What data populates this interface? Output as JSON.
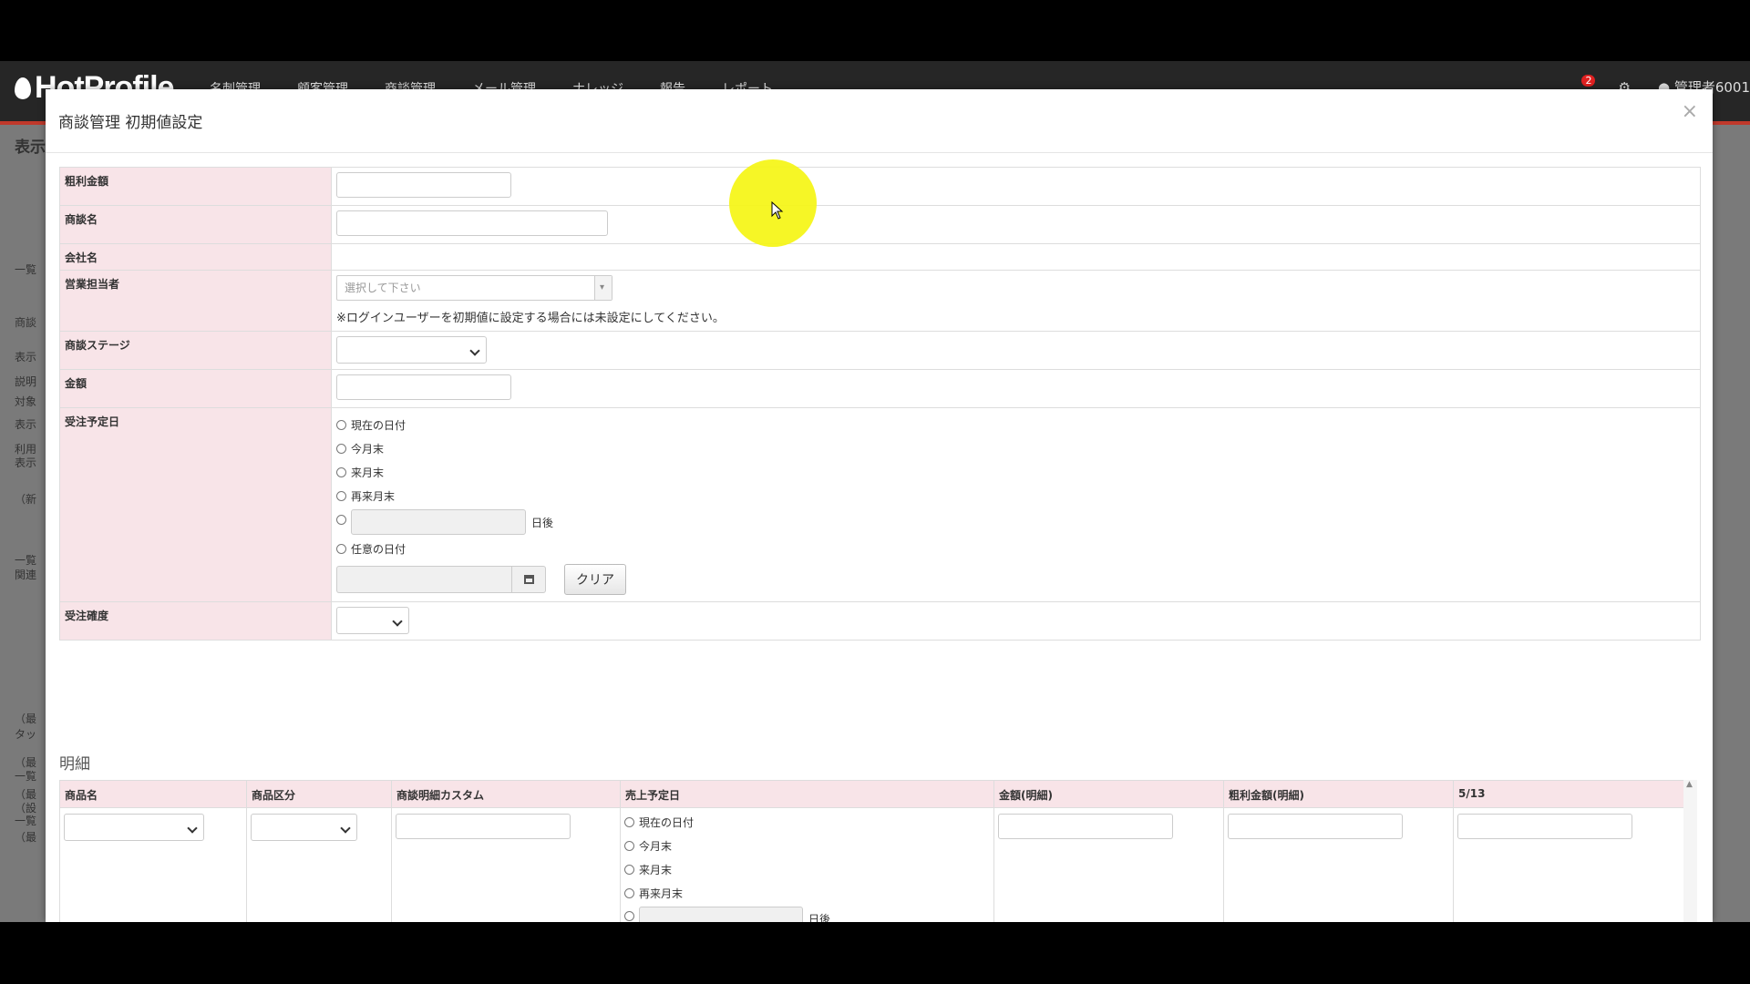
{
  "app": {
    "logo": "HotProfile",
    "nav": [
      "名刺管理",
      "顧客管理",
      "商談管理",
      "メール管理",
      "ナレッジ",
      "報告",
      "レポート"
    ],
    "notification_count": "2",
    "user": "管理者6001"
  },
  "background": {
    "page_title": "表示",
    "left_labels": [
      "一覧",
      "商談",
      "表示",
      "説明",
      "対象",
      "表示",
      "利用",
      "表示",
      "（新",
      "一覧",
      "関連",
      "（最",
      "タッ",
      "（最",
      "一覧",
      "（最",
      "（設",
      "一覧",
      "（最"
    ]
  },
  "modal": {
    "title": "商談管理 初期値設定",
    "close": "×",
    "fields": {
      "gross_profit": "粗利金額",
      "deal_name": "商談名",
      "company_name": "会社名",
      "sales_rep": "営業担当者",
      "sales_rep_placeholder": "選択して下さい",
      "sales_rep_note": "※ログインユーザーを初期値に設定する場合には未設定にしてください。",
      "deal_stage": "商談ステージ",
      "amount": "金額",
      "order_date": "受注予定日",
      "order_probability": "受注確度"
    },
    "date_options": {
      "today": "現在の日付",
      "end_this_month": "今月末",
      "end_next_month": "来月末",
      "end_month_after_next": "再来月末",
      "days_after": "日後",
      "any_date": "任意の日付"
    },
    "clear_label": "クリア",
    "details": {
      "section_title": "明細",
      "columns": [
        "商品名",
        "商品区分",
        "商談明細カスタム",
        "売上予定日",
        "金額(明細)",
        "粗利金額(明細)",
        "5/13"
      ]
    }
  }
}
